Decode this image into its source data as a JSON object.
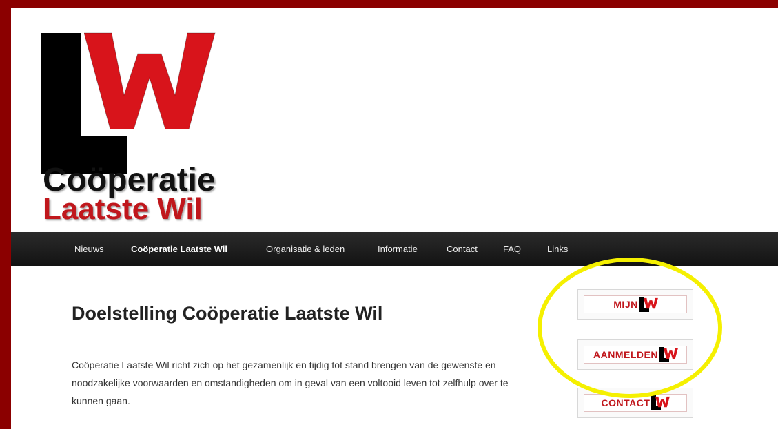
{
  "logo": {
    "line1": "Coöperatie",
    "line2": "Laatste Wil",
    "monogram": "LW"
  },
  "nav": {
    "items": [
      {
        "label": "Nieuws"
      },
      {
        "label": "Coöperatie Laatste Wil"
      },
      {
        "label": "Organisatie & leden"
      },
      {
        "label": "Informatie"
      },
      {
        "label": "Contact"
      },
      {
        "label": "FAQ"
      },
      {
        "label": "Links"
      }
    ],
    "active_index": 1
  },
  "main": {
    "title": "Doelstelling Coöperatie Laatste Wil",
    "paragraph": "Coöperatie Laatste Wil richt zich op het gezamenlijk en tijdig tot stand brengen van de gewenste en noodzakelijke voorwaarden en omstandigheden om in geval van een voltooid leven tot zelfhulp over te kunnen gaan."
  },
  "sidebar": {
    "buttons": [
      {
        "label": "MIJN"
      },
      {
        "label": "AANMELDEN"
      },
      {
        "label": "CONTACT"
      }
    ]
  },
  "colors": {
    "frame": "#8b0000",
    "brand_red": "#c0171c",
    "nav_bg": "#1e1e1e",
    "highlight": "#f5f000"
  }
}
